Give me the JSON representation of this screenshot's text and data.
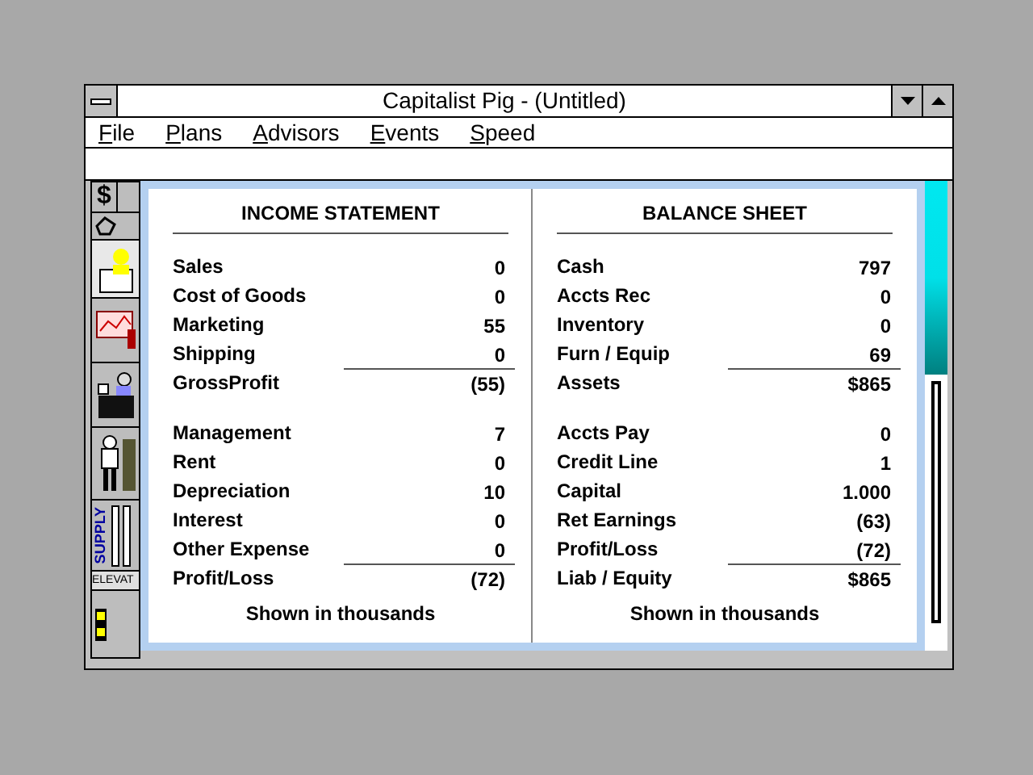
{
  "window": {
    "title": "Capitalist Pig - (Untitled)"
  },
  "menu": [
    {
      "label": "File"
    },
    {
      "label": "Plans"
    },
    {
      "label": "Advisors"
    },
    {
      "label": "Events"
    },
    {
      "label": "Speed"
    }
  ],
  "toolbar": {
    "dollar": "$",
    "supply": "SUPPLY",
    "elevator": "ELEVAT"
  },
  "statements": [
    {
      "title": "INCOME STATEMENT",
      "groups": [
        [
          {
            "label": "Sales",
            "value": "0",
            "rule_above": false
          },
          {
            "label": "Cost of Goods",
            "value": "0",
            "rule_above": false
          },
          {
            "label": "Marketing",
            "value": "55",
            "rule_above": false
          },
          {
            "label": "Shipping",
            "value": "0",
            "rule_above": false
          },
          {
            "label": "GrossProfit",
            "value": "(55)",
            "rule_above": true
          }
        ],
        [
          {
            "label": "Management",
            "value": "7",
            "rule_above": false
          },
          {
            "label": "Rent",
            "value": "0",
            "rule_above": false
          },
          {
            "label": "Depreciation",
            "value": "10",
            "rule_above": false
          },
          {
            "label": "Interest",
            "value": "0",
            "rule_above": false
          },
          {
            "label": "Other Expense",
            "value": "0",
            "rule_above": false
          },
          {
            "label": "Profit/Loss",
            "value": "(72)",
            "rule_above": true
          }
        ]
      ],
      "footer": "Shown in thousands"
    },
    {
      "title": "BALANCE SHEET",
      "groups": [
        [
          {
            "label": "Cash",
            "value": "797",
            "rule_above": false
          },
          {
            "label": "Accts Rec",
            "value": "0",
            "rule_above": false
          },
          {
            "label": "Inventory",
            "value": "0",
            "rule_above": false
          },
          {
            "label": "Furn / Equip",
            "value": "69",
            "rule_above": false
          },
          {
            "label": "Assets",
            "value": "$865",
            "rule_above": true
          }
        ],
        [
          {
            "label": "Accts Pay",
            "value": "0",
            "rule_above": false
          },
          {
            "label": "Credit Line",
            "value": "1",
            "rule_above": false
          },
          {
            "label": "Capital",
            "value": "1.000",
            "rule_above": false
          },
          {
            "label": "Ret Earnings",
            "value": "(63)",
            "rule_above": false
          },
          {
            "label": "Profit/Loss",
            "value": "(72)",
            "rule_above": false
          },
          {
            "label": "Liab / Equity",
            "value": "$865",
            "rule_above": true
          }
        ]
      ],
      "footer": "Shown in thousands"
    }
  ]
}
